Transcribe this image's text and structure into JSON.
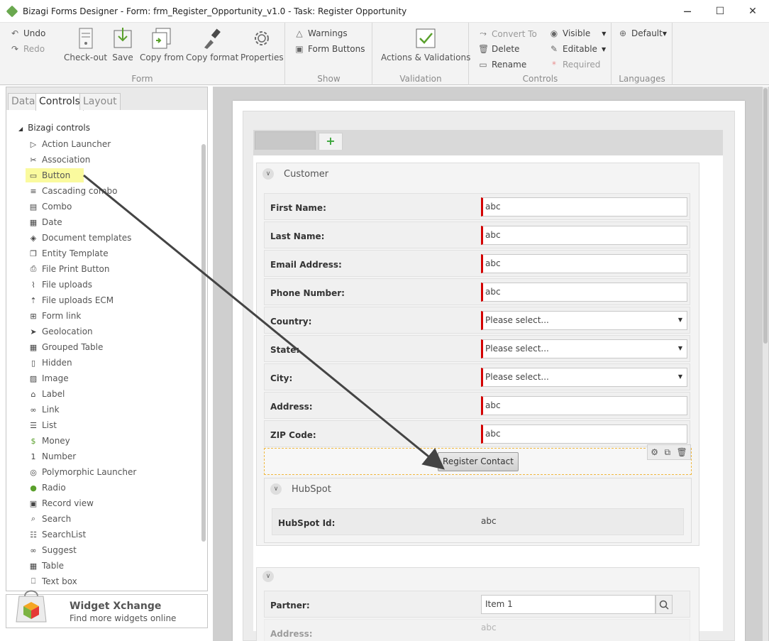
{
  "window": {
    "title": "Bizagi Forms Designer  - Form: frm_Register_Opportunity_v1.0 - Task:  Register Opportunity",
    "minimize": "─",
    "maximize": "☐",
    "close": "✕"
  },
  "ribbon": {
    "undo": "Undo",
    "redo": "Redo",
    "form_group": {
      "label": "Form",
      "checkout": "Check-out",
      "save": "Save",
      "copy_from": "Copy from",
      "copy_format": "Copy format",
      "properties": "Properties"
    },
    "show_group": {
      "label": "Show",
      "warnings": "Warnings",
      "form_buttons": "Form Buttons"
    },
    "validation_group": {
      "label": "Validation",
      "actions_validations": "Actions & Validations"
    },
    "controls_group": {
      "label": "Controls",
      "convert_to": "Convert To",
      "delete": "Delete",
      "rename": "Rename",
      "visible": "Visible",
      "editable": "Editable",
      "required": "Required"
    },
    "languages_group": {
      "label": "Languages",
      "default": "Default"
    }
  },
  "left_panel": {
    "tabs": [
      "Data",
      "Controls",
      "Layout"
    ],
    "active_tab": "Controls",
    "tree_root": "Bizagi controls",
    "items": [
      {
        "label": "Action Launcher",
        "icon": "play-icon"
      },
      {
        "label": "Association",
        "icon": "association-icon"
      },
      {
        "label": "Button",
        "icon": "button-icon"
      },
      {
        "label": "Cascading combo",
        "icon": "cascading-icon"
      },
      {
        "label": "Combo",
        "icon": "combo-icon"
      },
      {
        "label": "Date",
        "icon": "calendar-icon"
      },
      {
        "label": "Document templates",
        "icon": "document-template-icon"
      },
      {
        "label": "Entity Template",
        "icon": "entity-template-icon"
      },
      {
        "label": "File Print Button",
        "icon": "printer-icon"
      },
      {
        "label": "File uploads",
        "icon": "paperclip-icon"
      },
      {
        "label": "File uploads ECM",
        "icon": "upload-icon"
      },
      {
        "label": "Form link",
        "icon": "form-link-icon"
      },
      {
        "label": "Geolocation",
        "icon": "location-icon"
      },
      {
        "label": "Grouped Table",
        "icon": "grouped-table-icon"
      },
      {
        "label": "Hidden",
        "icon": "hidden-icon"
      },
      {
        "label": "Image",
        "icon": "image-icon"
      },
      {
        "label": "Label",
        "icon": "label-icon"
      },
      {
        "label": "Link",
        "icon": "link-icon"
      },
      {
        "label": "List",
        "icon": "list-icon"
      },
      {
        "label": "Money",
        "icon": "money-icon"
      },
      {
        "label": "Number",
        "icon": "number-icon"
      },
      {
        "label": "Polymorphic Launcher",
        "icon": "polymorphic-icon"
      },
      {
        "label": "Radio",
        "icon": "radio-icon"
      },
      {
        "label": "Record view",
        "icon": "record-view-icon"
      },
      {
        "label": "Search",
        "icon": "search-icon"
      },
      {
        "label": "SearchList",
        "icon": "searchlist-icon"
      },
      {
        "label": "Suggest",
        "icon": "suggest-icon"
      },
      {
        "label": "Table",
        "icon": "table-icon"
      },
      {
        "label": "Text box",
        "icon": "textbox-icon"
      }
    ],
    "highlighted_item": "Button"
  },
  "widget_xchange": {
    "title": "Widget Xchange",
    "subtitle": "Find more widgets online"
  },
  "form": {
    "customer_group": {
      "title": "Customer",
      "fields": [
        {
          "label": "First Name:",
          "value": "abc",
          "type": "text"
        },
        {
          "label": "Last Name:",
          "value": "abc",
          "type": "text"
        },
        {
          "label": "Email Address:",
          "value": "abc",
          "type": "text"
        },
        {
          "label": "Phone Number:",
          "value": "abc",
          "type": "text"
        },
        {
          "label": "Country:",
          "value": "Please select...",
          "type": "select"
        },
        {
          "label": "State:",
          "value": "Please select...",
          "type": "select"
        },
        {
          "label": "City:",
          "value": "Please select...",
          "type": "select"
        },
        {
          "label": "Address:",
          "value": "abc",
          "type": "text"
        },
        {
          "label": "ZIP Code:",
          "value": "abc",
          "type": "text"
        }
      ],
      "button_label": "Register Contact"
    },
    "hubspot_group": {
      "title": "HubSpot",
      "field_label": "HubSpot Id:",
      "field_value": "abc"
    },
    "partner_group": {
      "field_label": "Partner:",
      "field_value": "Item 1",
      "next_label": "Address:",
      "next_value": "abc"
    }
  },
  "colors": {
    "required_marker": "#d40000",
    "drop_highlight": "#fafa9e",
    "selection_border": "#f0b840"
  }
}
